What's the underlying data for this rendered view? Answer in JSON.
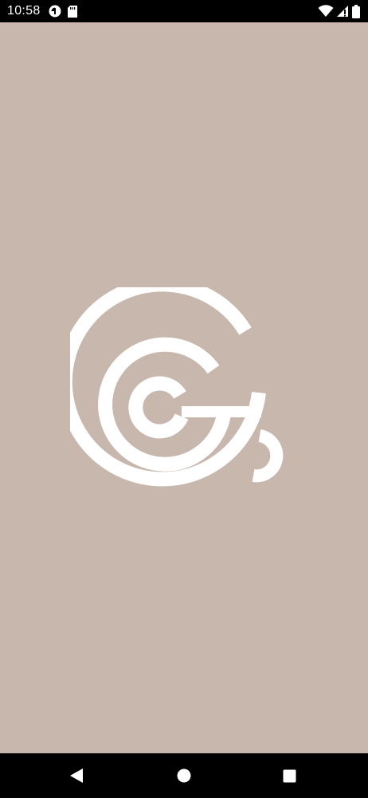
{
  "status_bar": {
    "time": "10:58",
    "left_icons": [
      "pie-icon",
      "sd-card-icon"
    ],
    "right_icons": [
      "wifi-icon",
      "cellular-signal-icon",
      "battery-icon"
    ]
  },
  "splash": {
    "logo_icon": "coffee-cup-logo-icon",
    "background_color": "#c7b7ad",
    "logo_color": "#ffffff"
  },
  "nav_bar": {
    "buttons": [
      "back-icon",
      "home-icon",
      "recents-icon"
    ]
  }
}
